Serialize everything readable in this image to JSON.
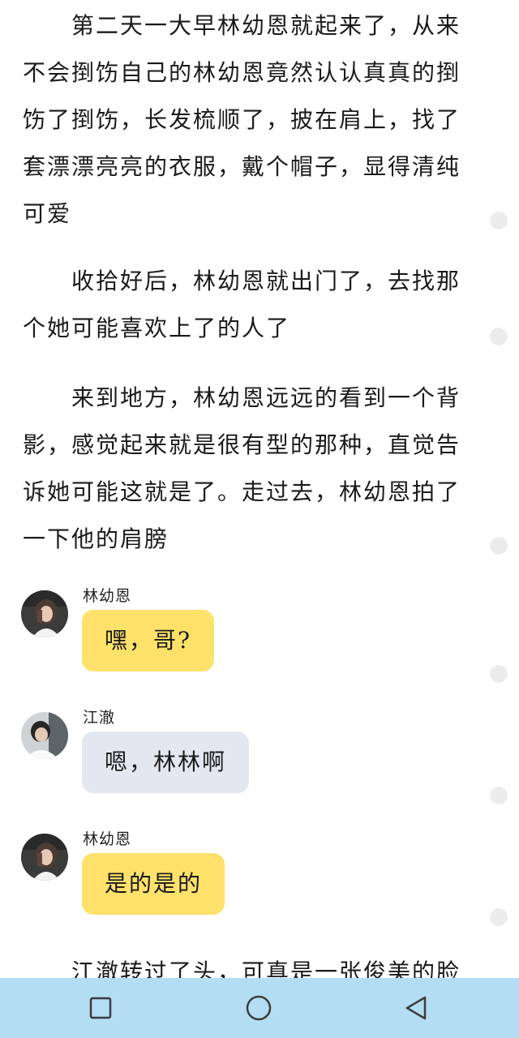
{
  "paragraphs": [
    "第二天一大早林幼恩就起来了，从来不会捯饬自己的林幼恩竟然认认真真的捯饬了捯饬，长发梳顺了，披在肩上，找了套漂漂亮亮的衣服，戴个帽子，显得清纯可爱",
    "收拾好后，林幼恩就出门了，去找那个她可能喜欢上了的人了",
    "来到地方，林幼恩远远的看到一个背影，感觉起来就是很有型的那种，直觉告诉她可能这就是了。走过去，林幼恩拍了一下他的肩膀",
    "江澈转过了头，可真是一张俊美的脸"
  ],
  "chat": [
    {
      "sender": "林幼恩",
      "text": "嘿，哥?",
      "style": "yellow",
      "avatar": "girl-avatar"
    },
    {
      "sender": "江澈",
      "text": "嗯，林林啊",
      "style": "gray",
      "avatar": "boy-avatar"
    },
    {
      "sender": "林幼恩",
      "text": "是的是的",
      "style": "yellow",
      "avatar": "girl-avatar"
    }
  ],
  "colors": {
    "bubble_yellow": "#fde16b",
    "bubble_gray": "#e3e8f0",
    "nav_bar": "#b3ddf3",
    "scroll_dot": "#ececec"
  },
  "navigation": {
    "recent_icon": "square-icon",
    "home_icon": "circle-icon",
    "back_icon": "triangle-back-icon"
  }
}
